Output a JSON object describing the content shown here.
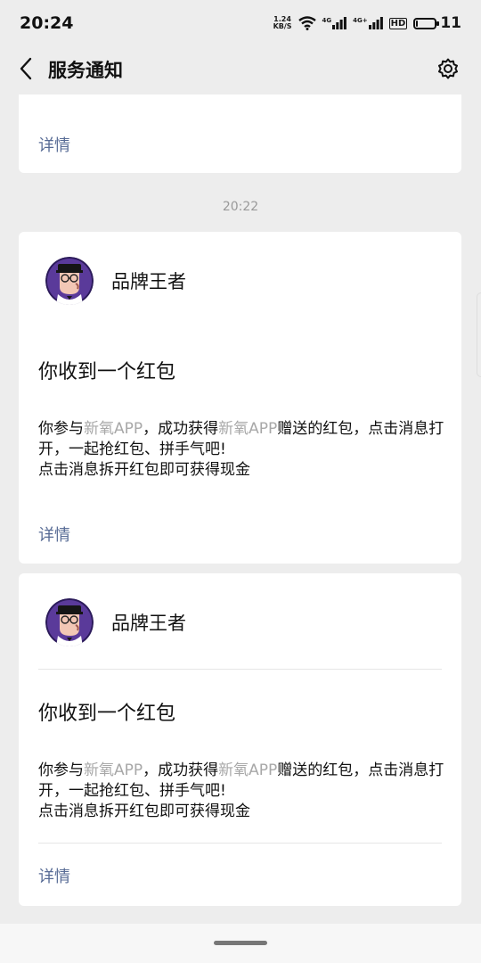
{
  "status_bar": {
    "time": "20:24",
    "net_speed_top": "1.24",
    "net_speed_bottom": "KB/S",
    "sig1_label": "4G",
    "sig2_label": "4G+",
    "hd_label": "HD",
    "battery_level": "11"
  },
  "nav": {
    "title": "服务通知",
    "back_icon": "chevron-left-icon",
    "settings_icon": "gear-icon"
  },
  "messages": [
    {
      "detail_label": "详情"
    },
    {
      "timestamp": "20:22",
      "sender": "品牌王者",
      "title": "你收到一个红包",
      "body_seg1": "你参与",
      "app_name_1": "新氧APP",
      "body_seg2": "，成功获得",
      "app_name_2": "新氧APP",
      "body_seg3": "赠送的红包，点击消息打开，一起抢红包、拼手气吧!",
      "body_line2": "点击消息拆开红包即可获得现金",
      "detail_label": "详情"
    },
    {
      "sender": "品牌王者",
      "title": "你收到一个红包",
      "body_seg1": "你参与",
      "app_name_1": "新氧APP",
      "body_seg2": "，成功获得",
      "app_name_2": "新氧APP",
      "body_seg3": "赠送的红包，点击消息打开，一起抢红包、拼手气吧!",
      "body_line2": "点击消息拆开红包即可获得现金",
      "detail_label": "详情"
    }
  ],
  "colors": {
    "link": "#576b95",
    "background": "#ededed",
    "muted_text": "#a8a8a8"
  }
}
